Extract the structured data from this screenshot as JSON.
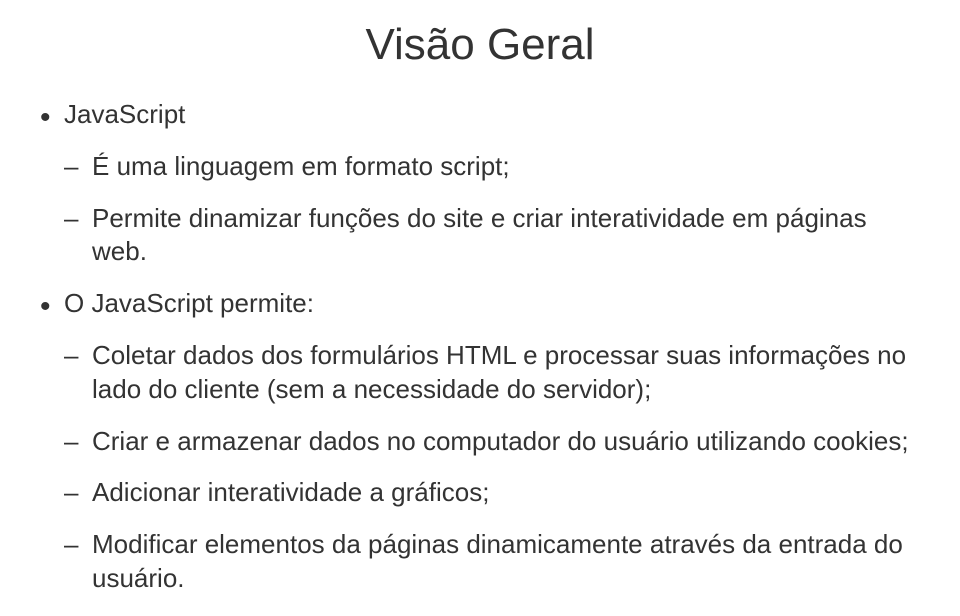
{
  "title": "Visão Geral",
  "items": [
    {
      "label": "JavaScript",
      "subitems": [
        "É uma linguagem em formato script;",
        "Permite dinamizar funções do site e criar interatividade em páginas web."
      ]
    },
    {
      "label": "O JavaScript permite:",
      "subitems": [
        "Coletar dados dos formulários HTML e processar suas informações no lado do cliente (sem a necessidade do servidor);",
        "Criar e armazenar dados no computador do usuário utilizando cookies;",
        "Adicionar interatividade a gráficos;",
        "Modificar elementos da páginas dinamicamente através da entrada do usuário."
      ]
    }
  ]
}
